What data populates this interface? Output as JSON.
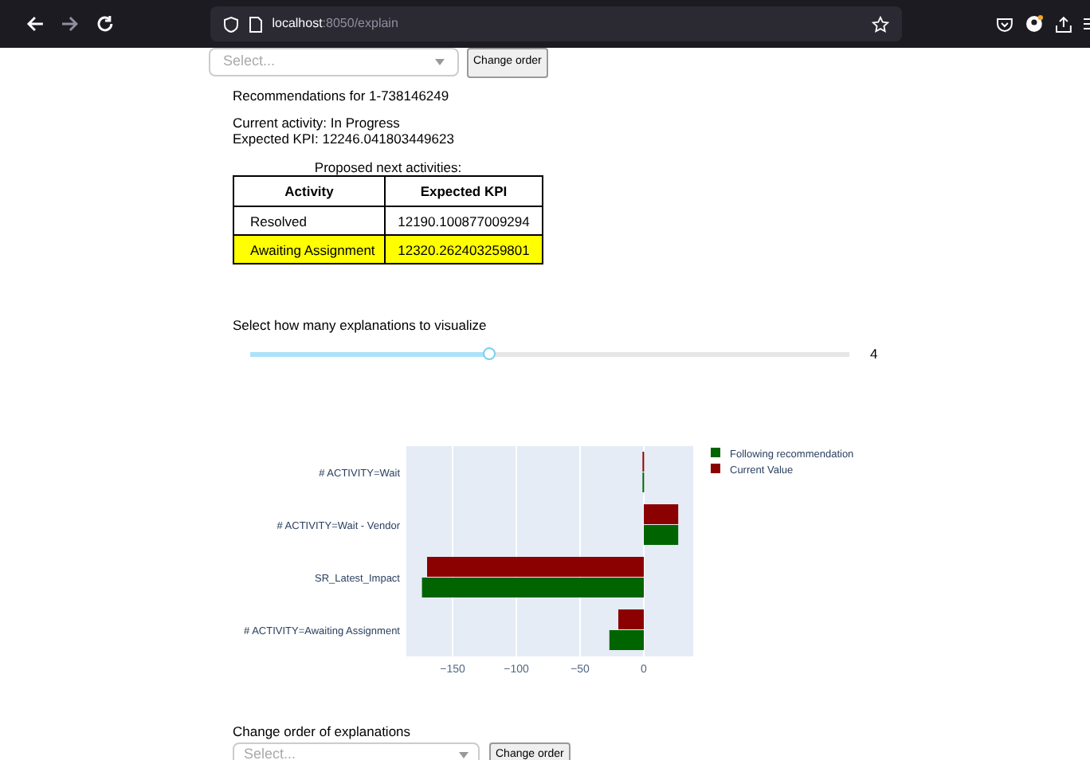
{
  "browser": {
    "url_host": "localhost",
    "url_path": ":8050/explain"
  },
  "top_selector": {
    "placeholder": "Select...",
    "button": "Change order"
  },
  "heading": "Recommendations for 1-738146249",
  "current_activity": "Current activity: In Progress",
  "expected_kpi": "Expected KPI: 12246.041803449623",
  "table": {
    "caption": "Proposed next activities:",
    "columns": [
      "Activity",
      "Expected KPI"
    ],
    "rows": [
      {
        "cells": [
          "Resolved",
          "12190.100877009294"
        ],
        "selected": false
      },
      {
        "cells": [
          "Awaiting Assignment",
          "12320.262403259801"
        ],
        "selected": true
      }
    ]
  },
  "slider": {
    "label": "Select how many explanations to visualize",
    "level": 0.4,
    "reading": "4"
  },
  "chart_data": {
    "type": "bar",
    "orientation": "h",
    "grid": true,
    "legend": true,
    "categories": [
      "# ACTIVITY=Wait",
      "# ACTIVITY=Wait - Vendor",
      "SR_Latest_Impact",
      "# ACTIVITY=Awaiting Assignment"
    ],
    "series": [
      {
        "name": "Following recommendation",
        "color": "#006400",
        "values": [
          -1,
          27,
          -174,
          -27
        ]
      },
      {
        "name": "Current Value",
        "color": "#8b0000",
        "values": [
          -1,
          27,
          -170,
          -20
        ]
      }
    ],
    "xlim": [
      -186.25,
      38.75
    ],
    "xticks": [
      {
        "value": -150,
        "label": "−150"
      },
      {
        "value": -100,
        "label": "−100"
      },
      {
        "value": -50,
        "label": "−50"
      },
      {
        "value": 0,
        "label": "0"
      }
    ]
  },
  "bottom_selector": {
    "label": "Change order of explanations",
    "placeholder": "Select...",
    "button": "Change order"
  }
}
